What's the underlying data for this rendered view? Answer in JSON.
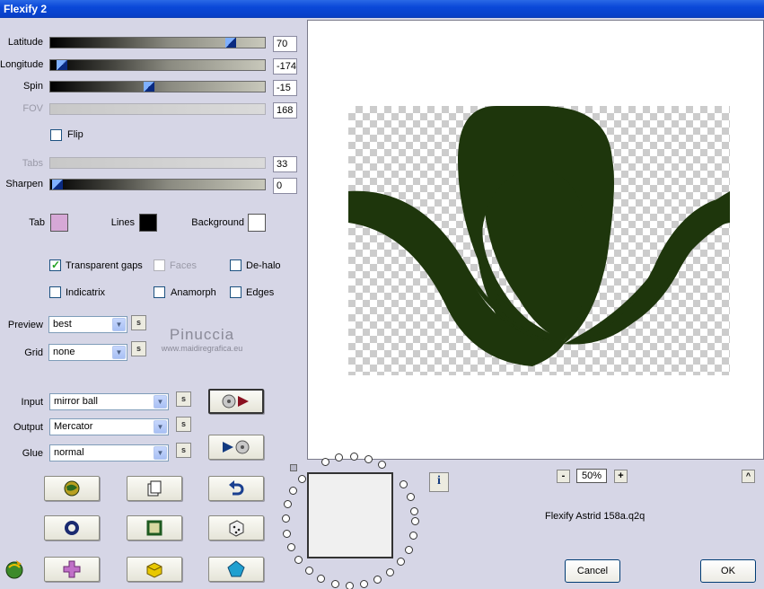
{
  "window": {
    "title": "Flexify 2"
  },
  "sliders": [
    {
      "label": "Latitude",
      "value": "70",
      "position": 0.86,
      "enabled": true
    },
    {
      "label": "Longitude",
      "value": "-174",
      "position": 0.03,
      "enabled": true
    },
    {
      "label": "Spin",
      "value": "-15",
      "position": 0.46,
      "enabled": true
    },
    {
      "label": "FOV",
      "value": "168",
      "enabled": false
    },
    {
      "label": "Tabs",
      "value": "33",
      "enabled": false
    },
    {
      "label": "Sharpen",
      "value": "0",
      "position": 0.01,
      "enabled": true
    }
  ],
  "flip": {
    "label": "Flip",
    "checked": false
  },
  "colors": {
    "tab": {
      "label": "Tab",
      "color": "#d6a8d6"
    },
    "lines": {
      "label": "Lines",
      "color": "#000000"
    },
    "background": {
      "label": "Background",
      "color": "#ffffff"
    }
  },
  "options": [
    {
      "label": "Transparent gaps",
      "checked": true,
      "enabled": true
    },
    {
      "label": "Faces",
      "checked": false,
      "enabled": false
    },
    {
      "label": "De-halo",
      "checked": false,
      "enabled": true
    },
    {
      "label": "Indicatrix",
      "checked": false,
      "enabled": true
    },
    {
      "label": "Anamorph",
      "checked": false,
      "enabled": true
    },
    {
      "label": "Edges",
      "checked": false,
      "enabled": true
    }
  ],
  "preview_select": {
    "label": "Preview",
    "value": "best"
  },
  "grid_select": {
    "label": "Grid",
    "value": "none"
  },
  "input_select": {
    "label": "Input",
    "value": "mirror ball"
  },
  "output_select": {
    "label": "Output",
    "value": "Mercator"
  },
  "glue_select": {
    "label": "Glue",
    "value": "normal"
  },
  "small_button_label": "s",
  "zoom": {
    "minus": "-",
    "value": "50%",
    "plus": "+",
    "up": "^"
  },
  "info_label": "i",
  "preset_name": "Flexify Astrid 158a.q2q",
  "buttons": {
    "cancel": "Cancel",
    "ok": "OK"
  },
  "watermark": {
    "line1": "Pinuccia",
    "line2": "www.maidiregrafica.eu"
  },
  "accent": {
    "shape_color": "#1e360c",
    "title_bar": "#0a48d8"
  }
}
